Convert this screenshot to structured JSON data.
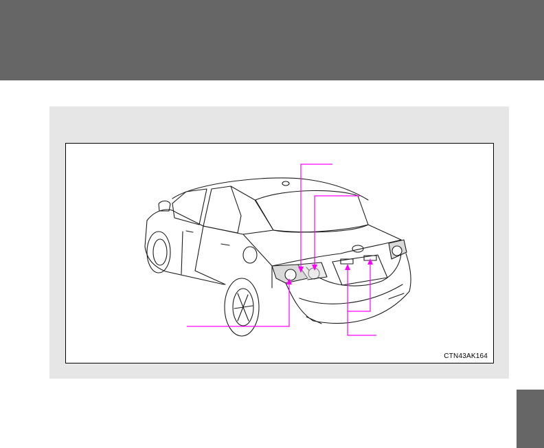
{
  "figure": {
    "code": "CTN43AK164",
    "callout_color": "#ff00ff"
  },
  "colors": {
    "header_band": "#666666",
    "panel": "#e6e6e6",
    "side_tab": "#666666"
  }
}
